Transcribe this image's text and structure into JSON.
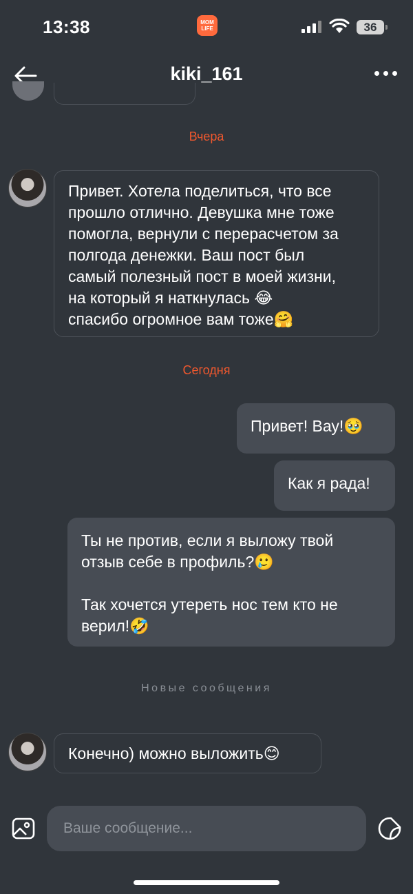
{
  "status_bar": {
    "time": "13:38",
    "app_icon_text": "MOM LIFE",
    "battery": "36"
  },
  "header": {
    "title": "kiki_161"
  },
  "colors": {
    "background": "#30353b",
    "accent": "#f0582e",
    "outgoing_bubble": "#474c54"
  },
  "dates": {
    "yesterday": "Вчера",
    "today": "Сегодня"
  },
  "messages": [
    {
      "direction": "in",
      "text": "Привет. Хотела поделиться, что все\nпрошло отлично. Девушка мне тоже\nпомогла, вернули с перерасчетом за\nполгода денежки. Ваш пост был\nсамый полезный пост в моей жизни,\nна который я наткнулась 😂\nспасибо огромное вам тоже🤗"
    },
    {
      "direction": "out",
      "text": "Привет! Вау!🥹"
    },
    {
      "direction": "out",
      "text": "Как я рада!"
    },
    {
      "direction": "out",
      "text": "Ты не против, если я выложу твой\nотзыв себе в профиль?🥲\n\nТак хочется утереть нос тем кто не\nверил!🤣"
    },
    {
      "direction": "in",
      "text": "Конечно) можно выложить😊"
    }
  ],
  "new_messages_label": "Новые сообщения",
  "composer": {
    "placeholder": "Ваше сообщение..."
  },
  "icons": {
    "back": "arrow-left-icon",
    "more": "more-dots-icon",
    "attach": "image-icon",
    "sticker": "sticker-icon"
  }
}
